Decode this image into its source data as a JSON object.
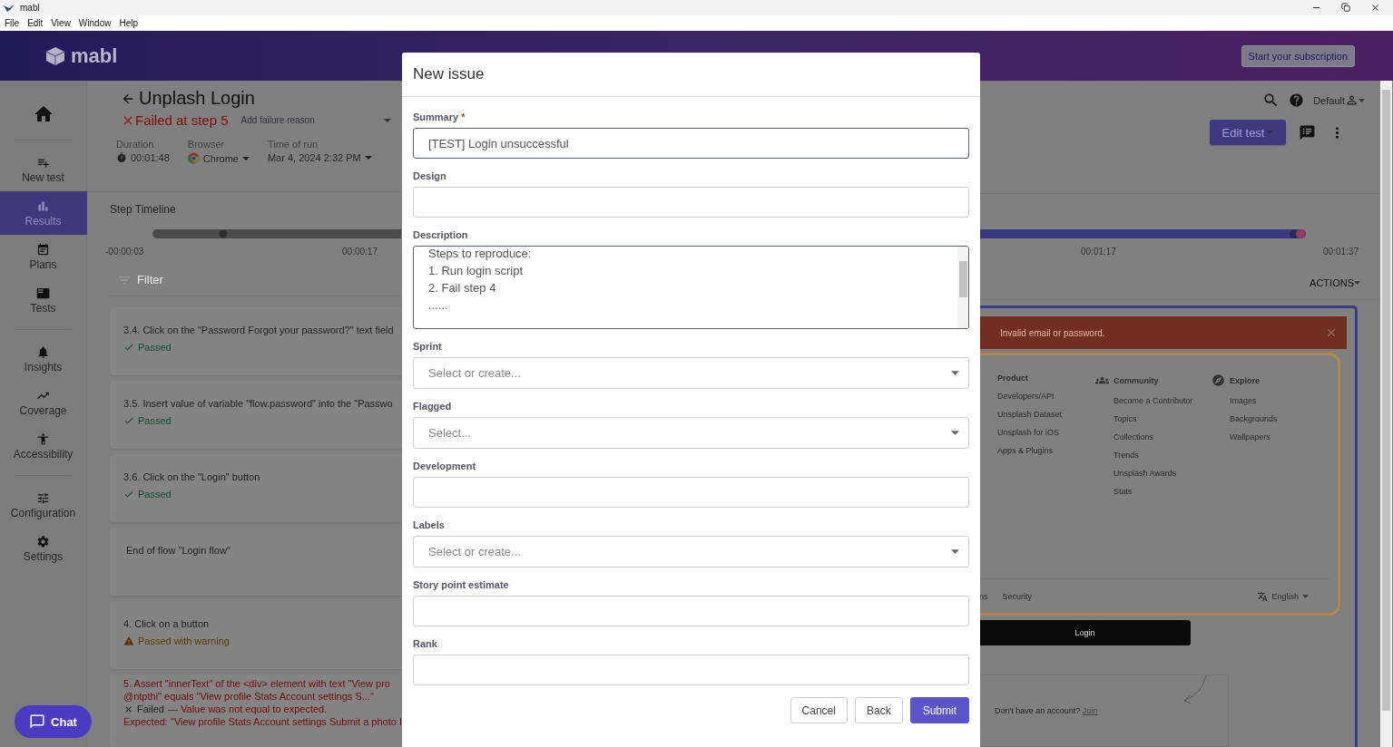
{
  "window": {
    "title": "mabl"
  },
  "menu": [
    "File",
    "Edit",
    "View",
    "Window",
    "Help"
  ],
  "header": {
    "logo": "mabl",
    "subscription_button": "Start your subscription"
  },
  "sidebar": {
    "groups": [
      {
        "items": [
          {
            "selected": false
          }
        ]
      },
      {
        "items": [
          {
            "label": "New test",
            "selected": false
          },
          {
            "label": "Results",
            "selected": true
          },
          {
            "label": "Plans",
            "selected": false
          },
          {
            "label": "Tests",
            "selected": false
          }
        ]
      },
      {
        "items": [
          {
            "label": "Insights",
            "selected": false
          },
          {
            "label": "Coverage",
            "selected": false
          },
          {
            "label": "Accessibility",
            "selected": false
          }
        ]
      },
      {
        "items": [
          {
            "label": "Configuration",
            "selected": false
          },
          {
            "label": "Settings",
            "selected": false
          }
        ]
      }
    ]
  },
  "chat_button": "Chat",
  "test": {
    "title": "Unplash Login",
    "status": "Failed at step 5",
    "failure_reason_placeholder": "Add failure reason",
    "meta": [
      {
        "label": "Duration",
        "value": "00:01:48"
      },
      {
        "label": "Browser",
        "value": "Chrome"
      },
      {
        "label": "Time of run",
        "value": "Mar 4, 2024 2:32 PM"
      }
    ]
  },
  "toolbar": {
    "workspace": "Default",
    "edit_button": "Edit test"
  },
  "timeline": {
    "title": "Step Timeline",
    "ticks": [
      "-00:00:03",
      "00:00:17",
      "00:01:17",
      "00:01:37"
    ]
  },
  "filter": {
    "placeholder": "Filter"
  },
  "actions_button": "ACTIONS",
  "steps": [
    {
      "kind": "passed",
      "title": "3.4. Click on the \"Password Forgot your password?\" text field",
      "status": "Passed"
    },
    {
      "kind": "passed",
      "title": "3.5. Insert value of variable \"flow.password\" into the \"Passwo",
      "status": "Passed"
    },
    {
      "kind": "passed",
      "title": "3.6. Click on the \"Login\" button",
      "status": "Passed"
    },
    {
      "kind": "plain",
      "title": "End of flow \"Login flow\""
    },
    {
      "kind": "warning",
      "title": "4. Click on a button",
      "status": "Passed with warning"
    },
    {
      "kind": "failed",
      "title": "5. Assert \"innerText\" of the <div> element with text \"View pro",
      "title_line_2": "@ntpthi\" equals \"View profile Stats Account settings S...\"",
      "status": "Failed",
      "message": "— Value was not equal to expected.",
      "expected": "Expected:  \"View profile Stats Account settings Submit a photo I"
    }
  ],
  "preview": {
    "error": "Invalid email or password.",
    "columns": [
      {
        "heading": "Product",
        "links": [
          "Developers/API",
          "Unsplash Dataset",
          "Unsplash for iOS",
          "Apps & Plugins"
        ]
      },
      {
        "heading": "Community",
        "links": [
          "Become a Contributor",
          "Topics",
          "Collections",
          "Trends",
          "Unsplash Awards",
          "Stats"
        ]
      },
      {
        "heading": "Explore",
        "links": [
          "Images",
          "Backgrounds",
          "Wallpapers"
        ]
      }
    ],
    "footer_links": [
      "ns",
      "Security"
    ],
    "language": "English",
    "login_button": "Login",
    "signup_prompt": "Don't have an account?",
    "signup_link": "Join"
  },
  "modal": {
    "title": "New issue",
    "fields": [
      {
        "label": "Summary",
        "required_mark": "*",
        "kind": "text",
        "value": "[TEST] Login unsuccessful"
      },
      {
        "label": "Design",
        "kind": "text"
      },
      {
        "label": "Description",
        "kind": "textarea",
        "lines": [
          "Steps to reproduce:",
          "1. Run login script",
          "2. Fail step 4",
          "......"
        ]
      },
      {
        "label": "Sprint",
        "kind": "select",
        "placeholder": "Select or create..."
      },
      {
        "label": "Flagged",
        "kind": "select",
        "placeholder": "Select..."
      },
      {
        "label": "Development",
        "kind": "text"
      },
      {
        "label": "Labels",
        "kind": "select",
        "placeholder": "Select or create..."
      },
      {
        "label": "Story point estimate",
        "kind": "text"
      },
      {
        "label": "Rank",
        "kind": "text"
      }
    ],
    "buttons": [
      {
        "label": "Cancel",
        "kind": "secondary"
      },
      {
        "label": "Back",
        "kind": "secondary"
      },
      {
        "label": "Submit",
        "kind": "primary"
      }
    ]
  }
}
